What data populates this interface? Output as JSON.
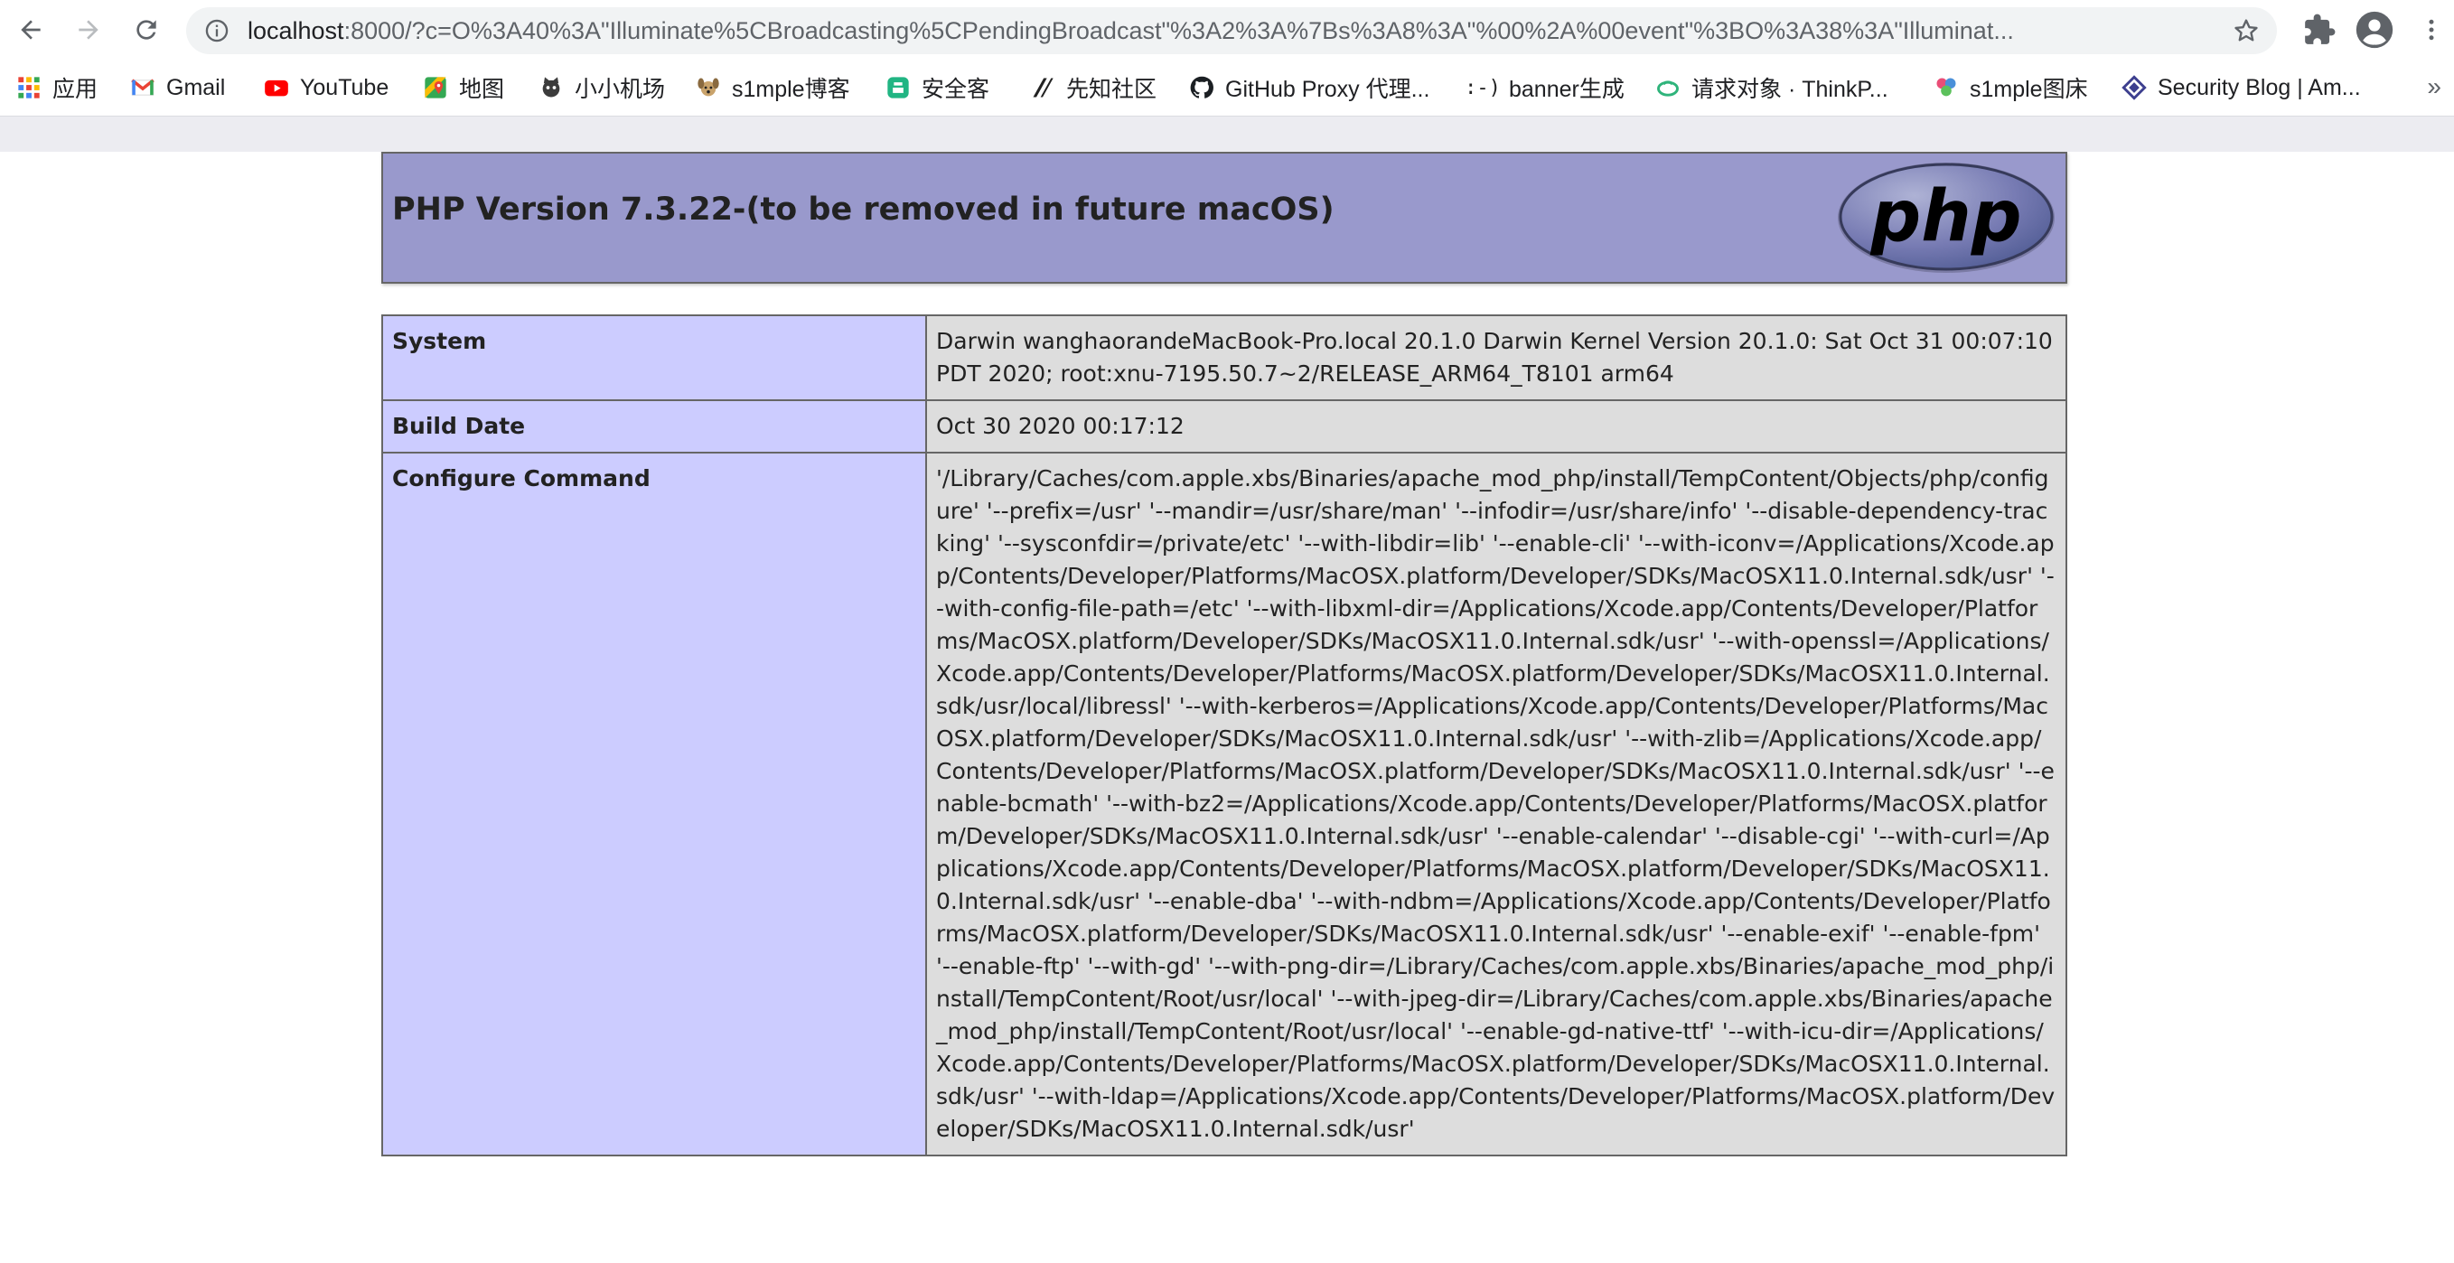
{
  "browser": {
    "url_host": "localhost",
    "url_rest": ":8000/?c=O%3A40%3A\"Illuminate%5CBroadcasting%5CPendingBroadcast\"%3A2%3A%7Bs%3A8%3A\"%00%2A%00event\"%3BO%3A38%3A\"Illuminat..."
  },
  "bookmarks": [
    {
      "label": "应用",
      "icon": "apps-grid-icon"
    },
    {
      "label": "Gmail",
      "icon": "gmail-icon"
    },
    {
      "label": "YouTube",
      "icon": "youtube-icon"
    },
    {
      "label": "地图",
      "icon": "maps-icon"
    },
    {
      "label": "小小机场",
      "icon": "cat-icon"
    },
    {
      "label": "s1mple博客",
      "icon": "dog-icon"
    },
    {
      "label": "安全客",
      "icon": "anquanke-icon"
    },
    {
      "label": "先知社区",
      "icon": "xianzhi-icon"
    },
    {
      "label": "GitHub Proxy 代理...",
      "icon": "github-icon"
    },
    {
      "label": "banner生成",
      "icon": "smiley-text-icon"
    },
    {
      "label": "请求对象 · ThinkP...",
      "icon": "thinkphp-icon"
    },
    {
      "label": "s1mple图床",
      "icon": "flower-icon"
    },
    {
      "label": "Security Blog | Am...",
      "icon": "diamond-icon"
    }
  ],
  "php": {
    "title": "PHP Version 7.3.22-(to be removed in future macOS)",
    "logo_text": "php",
    "rows": [
      {
        "key": "System",
        "value": "Darwin wanghaorandeMacBook-Pro.local 20.1.0 Darwin Kernel Version 20.1.0: Sat Oct 31 00:07:10 PDT 2020; root:xnu-7195.50.7~2/RELEASE_ARM64_T8101 arm64"
      },
      {
        "key": "Build Date",
        "value": "Oct 30 2020 00:17:12"
      },
      {
        "key": "Configure Command",
        "value": "'/Library/Caches/com.apple.xbs/Binaries/apache_mod_php/install/TempContent/Objects/php/configure' '--prefix=/usr' '--mandir=/usr/share/man' '--infodir=/usr/share/info' '--disable-dependency-tracking' '--sysconfdir=/private/etc' '--with-libdir=lib' '--enable-cli' '--with-iconv=/Applications/Xcode.app/Contents/Developer/Platforms/MacOSX.platform/Developer/SDKs/MacOSX11.0.Internal.sdk/usr' '--with-config-file-path=/etc' '--with-libxml-dir=/Applications/Xcode.app/Contents/Developer/Platforms/MacOSX.platform/Developer/SDKs/MacOSX11.0.Internal.sdk/usr' '--with-openssl=/Applications/Xcode.app/Contents/Developer/Platforms/MacOSX.platform/Developer/SDKs/MacOSX11.0.Internal.sdk/usr/local/libressl' '--with-kerberos=/Applications/Xcode.app/Contents/Developer/Platforms/MacOSX.platform/Developer/SDKs/MacOSX11.0.Internal.sdk/usr' '--with-zlib=/Applications/Xcode.app/Contents/Developer/Platforms/MacOSX.platform/Developer/SDKs/MacOSX11.0.Internal.sdk/usr' '--enable-bcmath' '--with-bz2=/Applications/Xcode.app/Contents/Developer/Platforms/MacOSX.platform/Developer/SDKs/MacOSX11.0.Internal.sdk/usr' '--enable-calendar' '--disable-cgi' '--with-curl=/Applications/Xcode.app/Contents/Developer/Platforms/MacOSX.platform/Developer/SDKs/MacOSX11.0.Internal.sdk/usr' '--enable-dba' '--with-ndbm=/Applications/Xcode.app/Contents/Developer/Platforms/MacOSX.platform/Developer/SDKs/MacOSX11.0.Internal.sdk/usr' '--enable-exif' '--enable-fpm' '--enable-ftp' '--with-gd' '--with-png-dir=/Library/Caches/com.apple.xbs/Binaries/apache_mod_php/install/TempContent/Root/usr/local' '--with-jpeg-dir=/Library/Caches/com.apple.xbs/Binaries/apache_mod_php/install/TempContent/Root/usr/local' '--enable-gd-native-ttf' '--with-icu-dir=/Applications/Xcode.app/Contents/Developer/Platforms/MacOSX.platform/Developer/SDKs/MacOSX11.0.Internal.sdk/usr' '--with-ldap=/Applications/Xcode.app/Contents/Developer/Platforms/MacOSX.platform/Developer/SDKs/MacOSX11.0.Internal.sdk/usr'"
      }
    ]
  },
  "colors": {
    "header_bg": "#9999cc",
    "key_cell_bg": "#ccccff",
    "value_cell_bg": "#dddddd",
    "border": "#666666"
  }
}
